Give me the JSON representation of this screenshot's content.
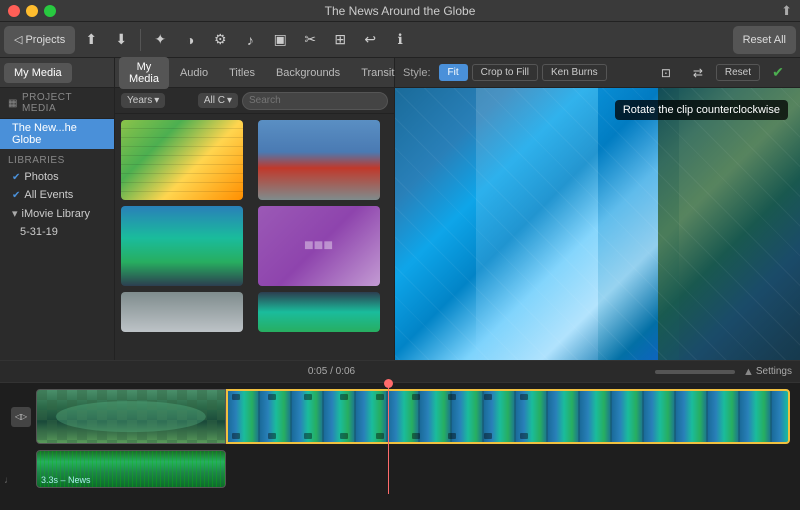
{
  "titleBar": {
    "title": "The News Around the Globe",
    "closeBtn": "×",
    "minBtn": "–",
    "maxBtn": "+"
  },
  "topToolbar": {
    "projectsBtn": "Projects",
    "resetAllBtn": "Reset All",
    "icons": [
      "⬆",
      "⬇",
      "✂",
      "⚙",
      "☰",
      "◑",
      "↩",
      "ℹ"
    ]
  },
  "mediaTabs": {
    "tabs": [
      "My Media",
      "Audio",
      "Titles",
      "Backgrounds",
      "Transitions"
    ]
  },
  "leftPanel": {
    "projectMediaLabel": "PROJECT MEDIA",
    "projectName": "The New...he Globe",
    "librariesLabel": "LIBRARIES",
    "photos": "Photos",
    "allEvents": "All Events",
    "iMovieLibrary": "iMovie Library",
    "date": "5-31-19"
  },
  "mediaGrid": {
    "filterLabel": "Years",
    "allLabel": "All C",
    "searchPlaceholder": "Search"
  },
  "preview": {
    "styleLabel": "Style:",
    "fitBtn": "Fit",
    "cropToFillBtn": "Crop to Fill",
    "kenBurnsBtn": "Ken Burns",
    "resetBtn": "Reset",
    "tooltip": "Rotate the clip counterclockwise",
    "timecode": "0:05 / 0:06"
  },
  "timeline": {
    "timecode": "0:05 / 0:06",
    "settingsBtn": "Settings",
    "audioLabel": "3.3s – News"
  }
}
